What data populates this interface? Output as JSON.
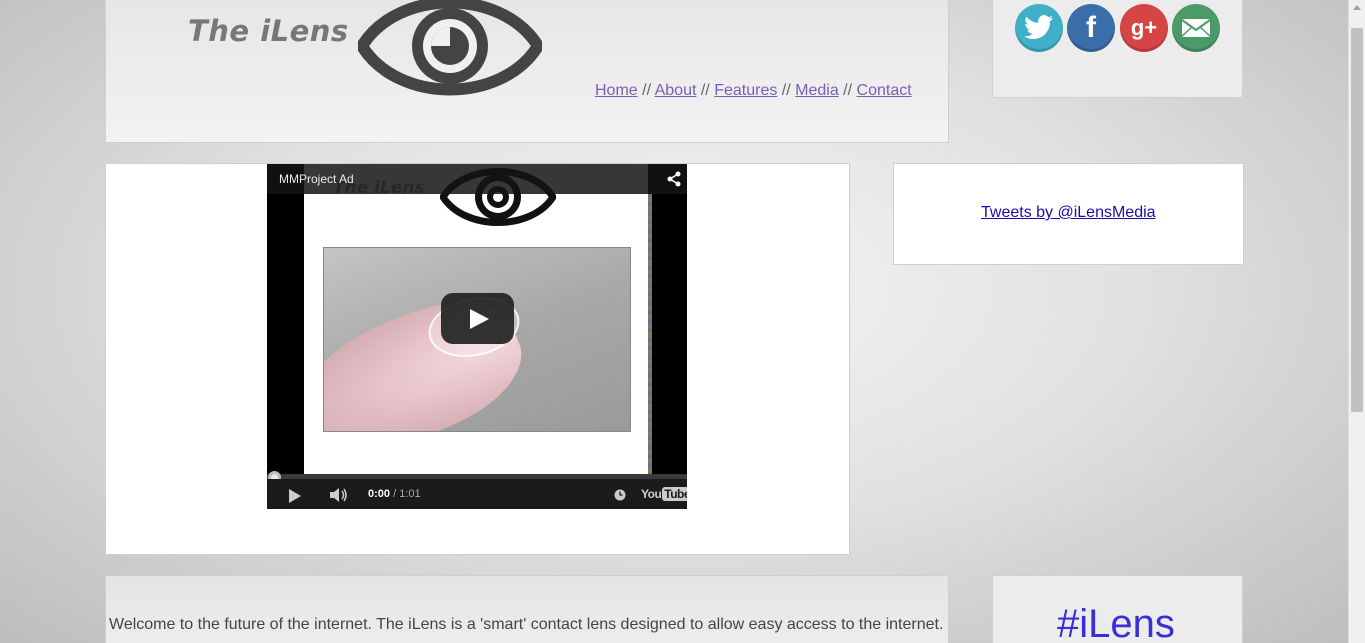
{
  "header": {
    "site_title": "The iLens",
    "nav": {
      "home": "Home",
      "about": "About",
      "features": "Features",
      "media": "Media",
      "contact": "Contact",
      "separator": "//"
    }
  },
  "social": {
    "twitter_label": "t",
    "facebook_label": "f",
    "googleplus_label": "g+",
    "colors": {
      "twitter": "#3fb0c7",
      "facebook": "#3a6ea8",
      "googleplus": "#d64545",
      "email": "#4c9a6a"
    }
  },
  "video": {
    "title": "MMProject Ad",
    "inner_title": "The iLens",
    "time_current": "0:00",
    "time_total": "/ 1:01",
    "brand_you": "You",
    "brand_tube": "Tube",
    "progress_fraction": 0
  },
  "tweets": {
    "link_text": "Tweets by @iLensMedia"
  },
  "welcome": {
    "text": "Welcome to the future of the internet. The iLens is a 'smart' contact lens designed to allow easy access to the internet."
  },
  "hashtag": {
    "text": "#iLens"
  }
}
